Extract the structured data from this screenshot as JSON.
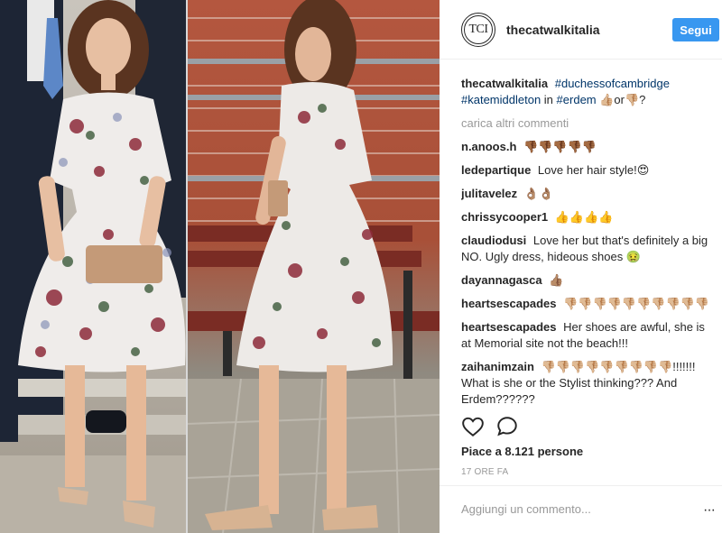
{
  "header": {
    "avatar_text": "TCI",
    "username": "thecatwalkitalia",
    "follow_label": "Segui"
  },
  "caption": {
    "user": "thecatwalkitalia",
    "tag1": "#duchessofcambridge",
    "tag2": "#katemiddleton",
    "in_text": "in",
    "tag3": "#erdem",
    "tail": "👍🏼or👎🏼?"
  },
  "load_more": "carica altri commenti",
  "comments": [
    {
      "user": "n.anoos.h",
      "text": "👎🏾👎🏾👎🏾👎🏾👎🏾"
    },
    {
      "user": "ledepartique",
      "text": "Love her hair style!😍"
    },
    {
      "user": "julitavelez",
      "text": "👌🏽👌🏽"
    },
    {
      "user": "chrissycooper1",
      "text": "👍👍👍👍"
    },
    {
      "user": "claudiodusi",
      "text": "Love her but that's definitely a big NO. Ugly dress, hideous shoes 🤢"
    },
    {
      "user": "dayannagasca",
      "text": "👍🏽"
    },
    {
      "user": "heartsescapades",
      "text": "👎🏼👎🏼👎🏼👎🏼👎🏼👎🏼👎🏼👎🏼👎🏼👎🏼"
    },
    {
      "user": "heartsescapades",
      "text": "Her shoes are awful, she is at Memorial site not the beach!!!"
    },
    {
      "user": "zaihanimzain",
      "text": "👎🏼👎🏼👎🏼👎🏼👎🏼👎🏼👎🏼👎🏼👎🏼!!!!!!! What is she or the Stylist thinking??? And Erdem??????"
    }
  ],
  "likes": "Piace a 8.121 persone",
  "timestamp": "17 ORE FA",
  "add_comment_placeholder": "Aggiungi un commento...",
  "more_icon_text": "···",
  "icons": [
    "heart-icon",
    "comment-icon",
    "more-options-icon"
  ],
  "colors": {
    "follow": "#3897f0",
    "tag": "#003569",
    "muted": "#999999"
  }
}
